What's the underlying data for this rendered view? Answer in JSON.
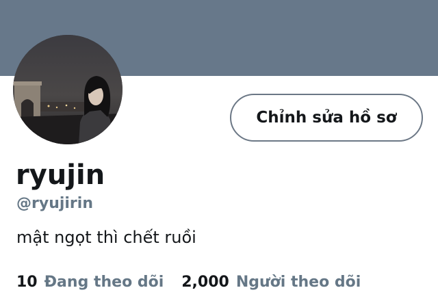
{
  "profile": {
    "display_name": "ryujin",
    "handle": "@ryujirin",
    "bio": "mật ngọt thì chết ruồi",
    "edit_button_label": "Chỉnh sửa hồ sơ"
  },
  "stats": {
    "following_count": "10",
    "following_label": "Đang theo dõi",
    "followers_count": "2,000",
    "followers_label": "Người theo dõi"
  },
  "colors": {
    "banner": "#67788a",
    "primary_text": "#14171a",
    "secondary_text": "#657786",
    "button_border": "#6b7785"
  }
}
